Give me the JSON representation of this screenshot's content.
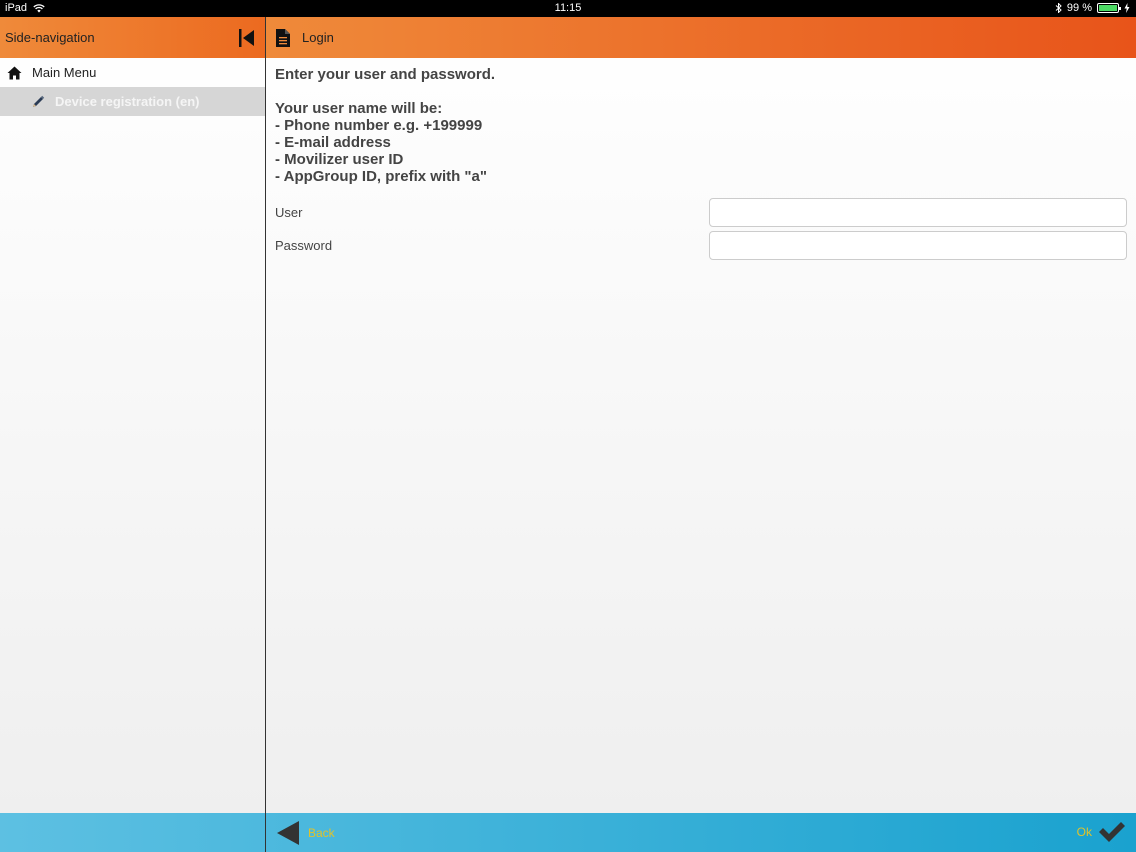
{
  "status_bar": {
    "device": "iPad",
    "time": "11:15",
    "battery_percent": "99 %",
    "icons": [
      "wifi-icon",
      "bluetooth-icon",
      "battery-icon",
      "charging-icon"
    ]
  },
  "sidebar": {
    "title": "Side-navigation",
    "collapse_icon": "collapse-left-icon",
    "main_menu_label": "Main Menu",
    "main_menu_icon": "home-icon",
    "selected_item_label": "Device registration (en)",
    "selected_item_icon": "pencil-icon"
  },
  "main": {
    "header_title": "Login",
    "header_icon": "document-icon",
    "instructions": {
      "line1": "Enter your user and password.",
      "line2": "Your user name will be:",
      "line3": "- Phone number e.g. +199999",
      "line4": "- E-mail address",
      "line5": "- Movilizer user ID",
      "line6": "- AppGroup ID, prefix with \"a\""
    },
    "form": {
      "user_label": "User",
      "user_value": "",
      "password_label": "Password",
      "password_value": ""
    }
  },
  "bottom_bar": {
    "back_label": "Back",
    "ok_label": "Ok"
  },
  "colors": {
    "header_orange": "#ec6a20",
    "bottom_blue": "#1aa2cf",
    "button_text_yellow": "#e0c32c",
    "battery_green": "#4cd964"
  }
}
